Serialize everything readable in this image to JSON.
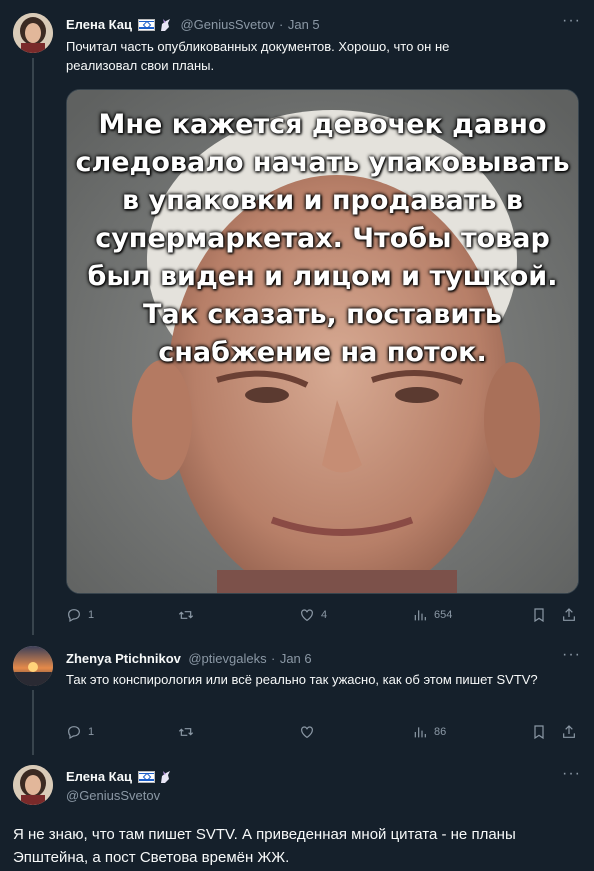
{
  "tweets": [
    {
      "author": "Елена Кац",
      "handle": "@GeniusSvetov",
      "date": "Jan 5",
      "text": "Почитал часть опубликованных документов. Хорошо, что он не реализовал свои планы.",
      "image_text": "Мне кажется  девочек давно\nследовало начать упаковывать\nв упаковки и продавать в\nсупермаркетах. Чтобы товар\nбыл виден и лицом и тушкой.\nТак сказать, поставить\nснабжение на поток.",
      "stats": {
        "replies": "1",
        "retweets": "",
        "likes": "4",
        "views": "654"
      }
    },
    {
      "author": "Zhenya Ptichnikov",
      "handle": "@ptievgaleks",
      "date": "Jan 6",
      "text": "Так это конспирология или всё реально так ужасно, как об этом пишет SVTV?",
      "stats": {
        "replies": "1",
        "retweets": "",
        "likes": "",
        "views": "86"
      }
    },
    {
      "author": "Елена Кац",
      "handle": "@GeniusSvetov",
      "text": "Я не знаю, что там пишет SVTV. А приведенная мной цитата - не планы Эпштейна, а пост Светова времён ЖЖ."
    }
  ],
  "separator": "·",
  "more_label": "···",
  "colors": {
    "background": "#15202b",
    "secondary_text": "#8b98a5",
    "thread_line": "#38444d"
  }
}
